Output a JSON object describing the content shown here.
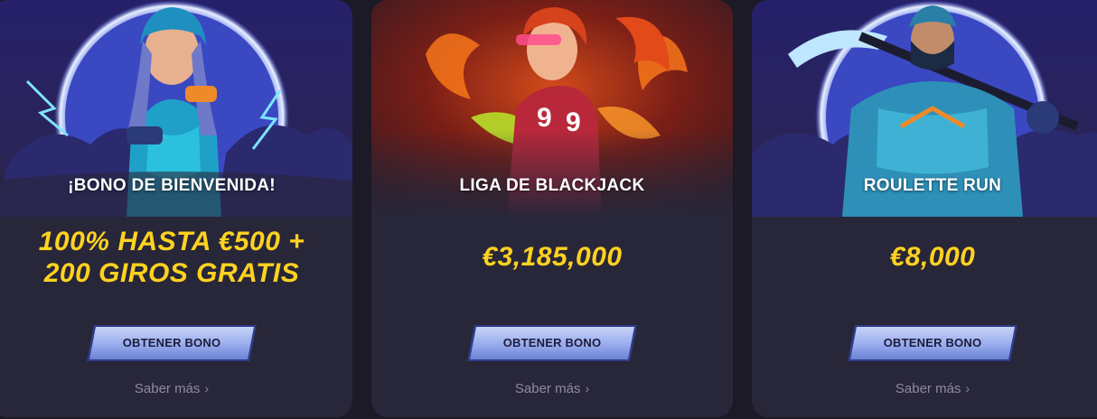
{
  "cards": [
    {
      "title": "¡BONO DE BIENVENIDA!",
      "amount_line1": "100% HASTA €500 +",
      "amount_line2": "200 GIROS GRATIS",
      "button_label": "OBTENER BONO",
      "more_label": "Saber más",
      "more_chevron": "›"
    },
    {
      "title": "LIGA DE BLACKJACK",
      "amount": "€3,185,000",
      "button_label": "OBTENER BONO",
      "more_label": "Saber más",
      "more_chevron": "›"
    },
    {
      "title": "ROULETTE RUN",
      "amount": "€8,000",
      "button_label": "OBTENER BONO",
      "more_label": "Saber más",
      "more_chevron": "›"
    }
  ],
  "colors": {
    "page_bg": "#1b1a26",
    "card_bg": "#282639",
    "amount": "#ffd21f",
    "button_fill_top": "#b8c8f5",
    "button_fill_bottom": "#6f86d6",
    "more_text": "#8c8aa3"
  }
}
